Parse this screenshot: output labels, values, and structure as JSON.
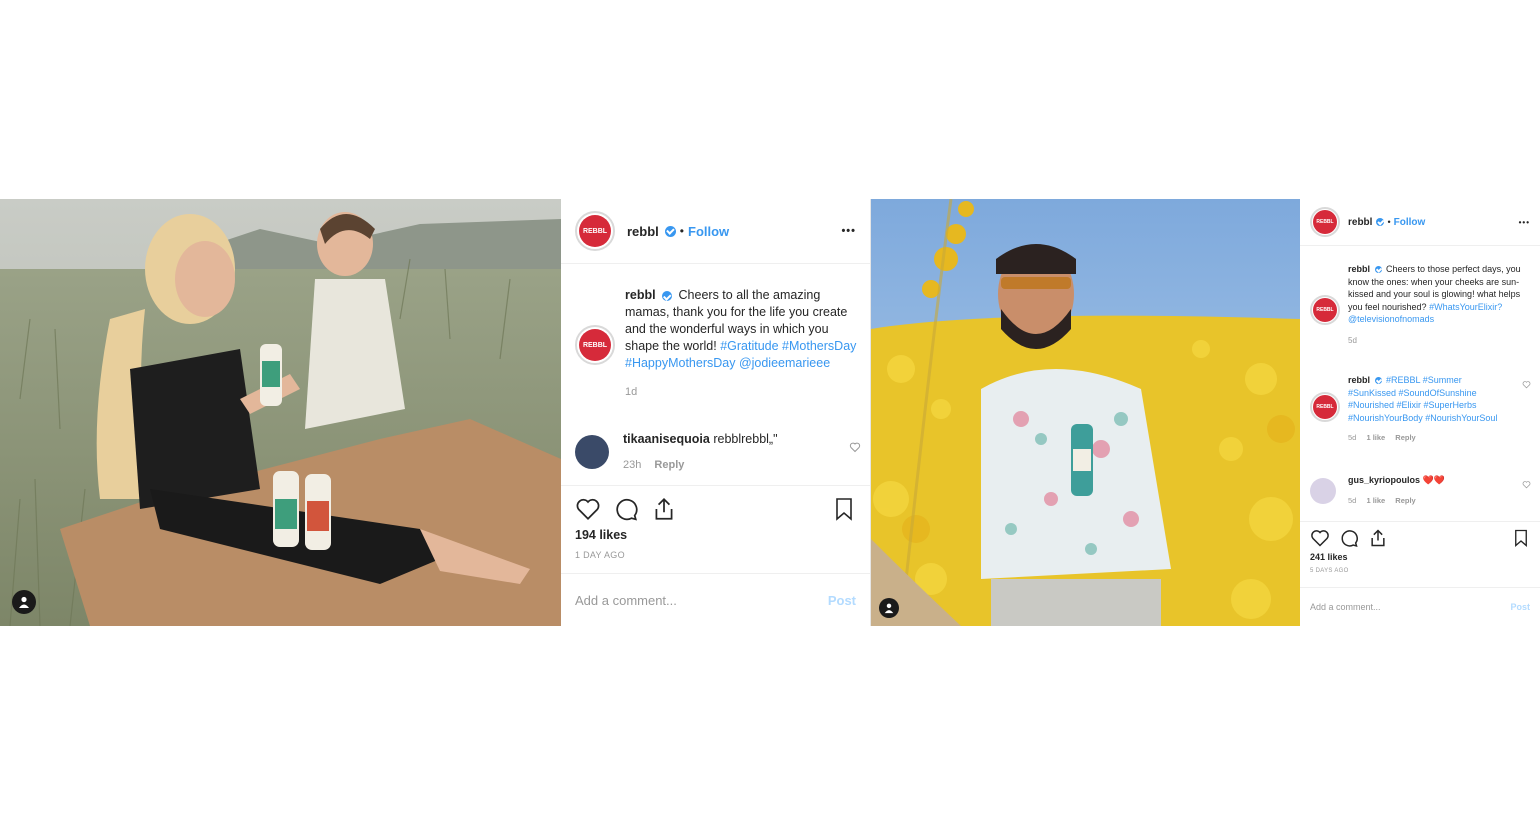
{
  "posts": [
    {
      "account": "rebbl",
      "follow_label": "Follow",
      "more_label": "•••",
      "avatar_text": "REBBL",
      "caption_text": "Cheers to all the amazing mamas, thank you for the life you create and the wonderful ways in which you shape the world!",
      "caption_tags": "#Gratitude #MothersDay #HappyMothersDay @jodieemarieee",
      "caption_time": "1d",
      "comments": [
        {
          "user": "tikaanisequoia",
          "text": "rebblrebbl„\"",
          "time": "23h",
          "reply_label": "Reply"
        }
      ],
      "likes": "194 likes",
      "date": "1 DAY AGO",
      "comment_placeholder": "Add a comment...",
      "post_label": "Post"
    },
    {
      "account": "rebbl",
      "follow_label": "Follow",
      "more_label": "•••",
      "avatar_text": "REBBL",
      "caption_text": "Cheers to those perfect days, you know the ones: when your cheeks are sun-kissed and your soul is glowing! what helps you feel nourished?",
      "caption_tags": "#WhatsYourElixir? @televisionofnomads",
      "caption_time": "5d",
      "comments": [
        {
          "user": "rebbl",
          "text": "",
          "tags": "#REBBL #Summer #SunKissed #SoundOfSunshine #Nourished #Elixir #SuperHerbs #NourishYourBody #NourishYourSoul",
          "time": "5d",
          "likes": "1 like",
          "reply_label": "Reply"
        },
        {
          "user": "gus_kyriopoulos",
          "text": "❤️❤️",
          "time": "5d",
          "likes": "1 like",
          "reply_label": "Reply"
        }
      ],
      "likes": "241 likes",
      "date": "5 DAYS AGO",
      "comment_placeholder": "Add a comment...",
      "post_label": "Post"
    }
  ]
}
